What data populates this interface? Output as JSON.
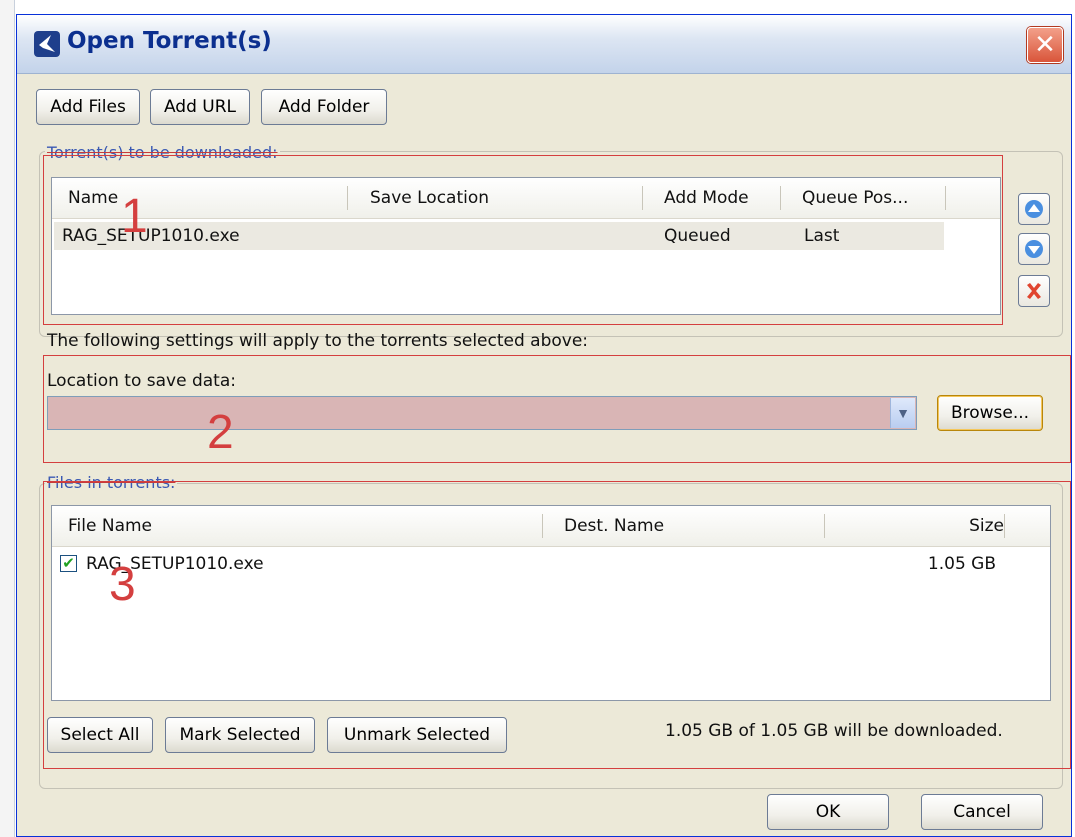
{
  "dialog": {
    "title": "Open Torrent(s)",
    "close_glyph": "✕"
  },
  "toolbar": {
    "add_files": "Add Files",
    "add_url": "Add URL",
    "add_folder": "Add Folder"
  },
  "torrents_group": {
    "label": "Torrent(s) to be downloaded:",
    "columns": [
      "Name",
      "Save Location",
      "Add Mode",
      "Queue Pos..."
    ],
    "rows": [
      {
        "name": "RAG_SETUP1010.exe",
        "save_location": "",
        "add_mode": "Queued",
        "queue_pos": "Last"
      }
    ],
    "buttons": {
      "up": "arrow-up-icon",
      "down": "arrow-down-icon",
      "remove": "remove-icon"
    }
  },
  "settings_note": "The following settings will apply to the torrents selected above:",
  "save_location": {
    "label": "Location to save data:",
    "value": "",
    "browse": "Browse..."
  },
  "files_group": {
    "label": "Files in torrents:",
    "columns": [
      "File Name",
      "Dest. Name",
      "Size"
    ],
    "rows": [
      {
        "checked": true,
        "file_name": "RAG_SETUP1010.exe",
        "dest_name": "",
        "size": "1.05 GB"
      }
    ],
    "select_all": "Select All",
    "mark_selected": "Mark Selected",
    "unmark_selected": "Unmark Selected",
    "summary": "1.05 GB of 1.05 GB will be downloaded."
  },
  "footer": {
    "ok": "OK",
    "cancel": "Cancel"
  },
  "annotations": [
    "1",
    "2",
    "3"
  ],
  "colors": {
    "annotation_red": "#d43f3f",
    "dialog_bg": "#ece9d8",
    "title_text": "#0b2f8f",
    "group_label": "#3a59b3",
    "combo_bg": "#d9b5b5"
  }
}
